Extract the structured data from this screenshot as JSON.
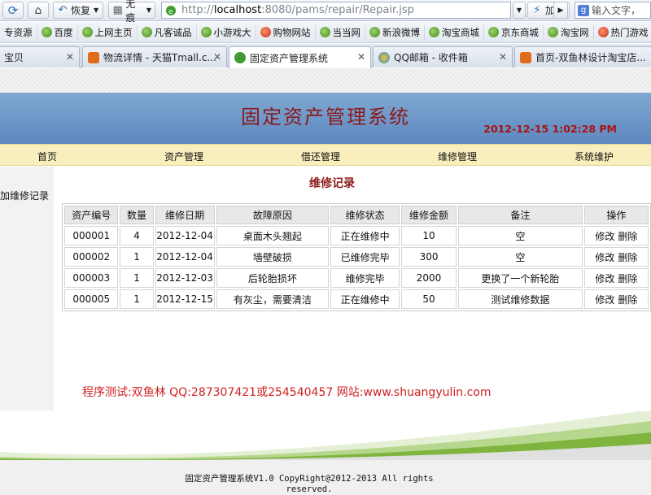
{
  "toolbar": {
    "back_label": "恢复",
    "trace_label": "无痕",
    "url_prefix": "http://",
    "url_host": "localhost",
    "url_rest": ":8080/pams/repair/Repair.jsp",
    "speed_label": "加速",
    "search_placeholder": "输入文字，"
  },
  "favorites": [
    {
      "label": "专资源"
    },
    {
      "label": "百度"
    },
    {
      "label": "上网主页"
    },
    {
      "label": "凡客诚品"
    },
    {
      "label": "小游戏大"
    },
    {
      "label": "购物网站"
    },
    {
      "label": "当当网"
    },
    {
      "label": "新浪微博"
    },
    {
      "label": "淘宝商城"
    },
    {
      "label": "京东商城"
    },
    {
      "label": "淘宝网"
    },
    {
      "label": "热门游戏"
    },
    {
      "label": "一"
    }
  ],
  "tabs": [
    {
      "label": "宝贝"
    },
    {
      "label": "物流详情 - 天猫Tmall.c..."
    },
    {
      "label": "固定资产管理系统"
    },
    {
      "label": "QQ邮箱 - 收件箱"
    },
    {
      "label": "首页-双鱼林设计淘宝店..."
    }
  ],
  "header": {
    "title": "固定资产管理系统",
    "datetime": "2012-12-15 1:02:28 PM"
  },
  "nav": {
    "items": [
      "首页",
      "资产管理",
      "借还管理",
      "维修管理",
      "系统维护"
    ]
  },
  "sidebar": {
    "link": "加维修记录"
  },
  "main": {
    "title": "维修记录",
    "columns": [
      "资产编号",
      "数量",
      "维修日期",
      "故障原因",
      "维修状态",
      "维修金额",
      "备注",
      "操作"
    ],
    "rows": [
      {
        "id": "000001",
        "qty": "4",
        "date": "2012-12-04",
        "reason": "桌面木头翘起",
        "status": "正在维修中",
        "amount": "10",
        "note": "空"
      },
      {
        "id": "000002",
        "qty": "1",
        "date": "2012-12-04",
        "reason": "墙壁破损",
        "status": "已维修完毕",
        "amount": "300",
        "note": "空"
      },
      {
        "id": "000003",
        "qty": "1",
        "date": "2012-12-03",
        "reason": "后轮胎损坏",
        "status": "维修完毕",
        "amount": "2000",
        "note": "更换了一个新轮胎"
      },
      {
        "id": "000005",
        "qty": "1",
        "date": "2012-12-15",
        "reason": "有灰尘，需要清洁",
        "status": "正在维修中",
        "amount": "50",
        "note": "测试维修数据"
      }
    ],
    "edit_label": "修改",
    "delete_label": "删除"
  },
  "footer": {
    "note": "程序测试:双鱼林 QQ:287307421或254540457 网站:www.shuangyulin.com",
    "copyright_line1": "固定资产管理系统V1.0 CopyRight@2012-2013 All rights",
    "copyright_line2": "reserved."
  },
  "colors": {
    "banner": "#6d97c8",
    "title": "#8b1a1a",
    "time": "#aa1111",
    "navbar": "#f9efbd",
    "footer_note": "#d02020"
  }
}
